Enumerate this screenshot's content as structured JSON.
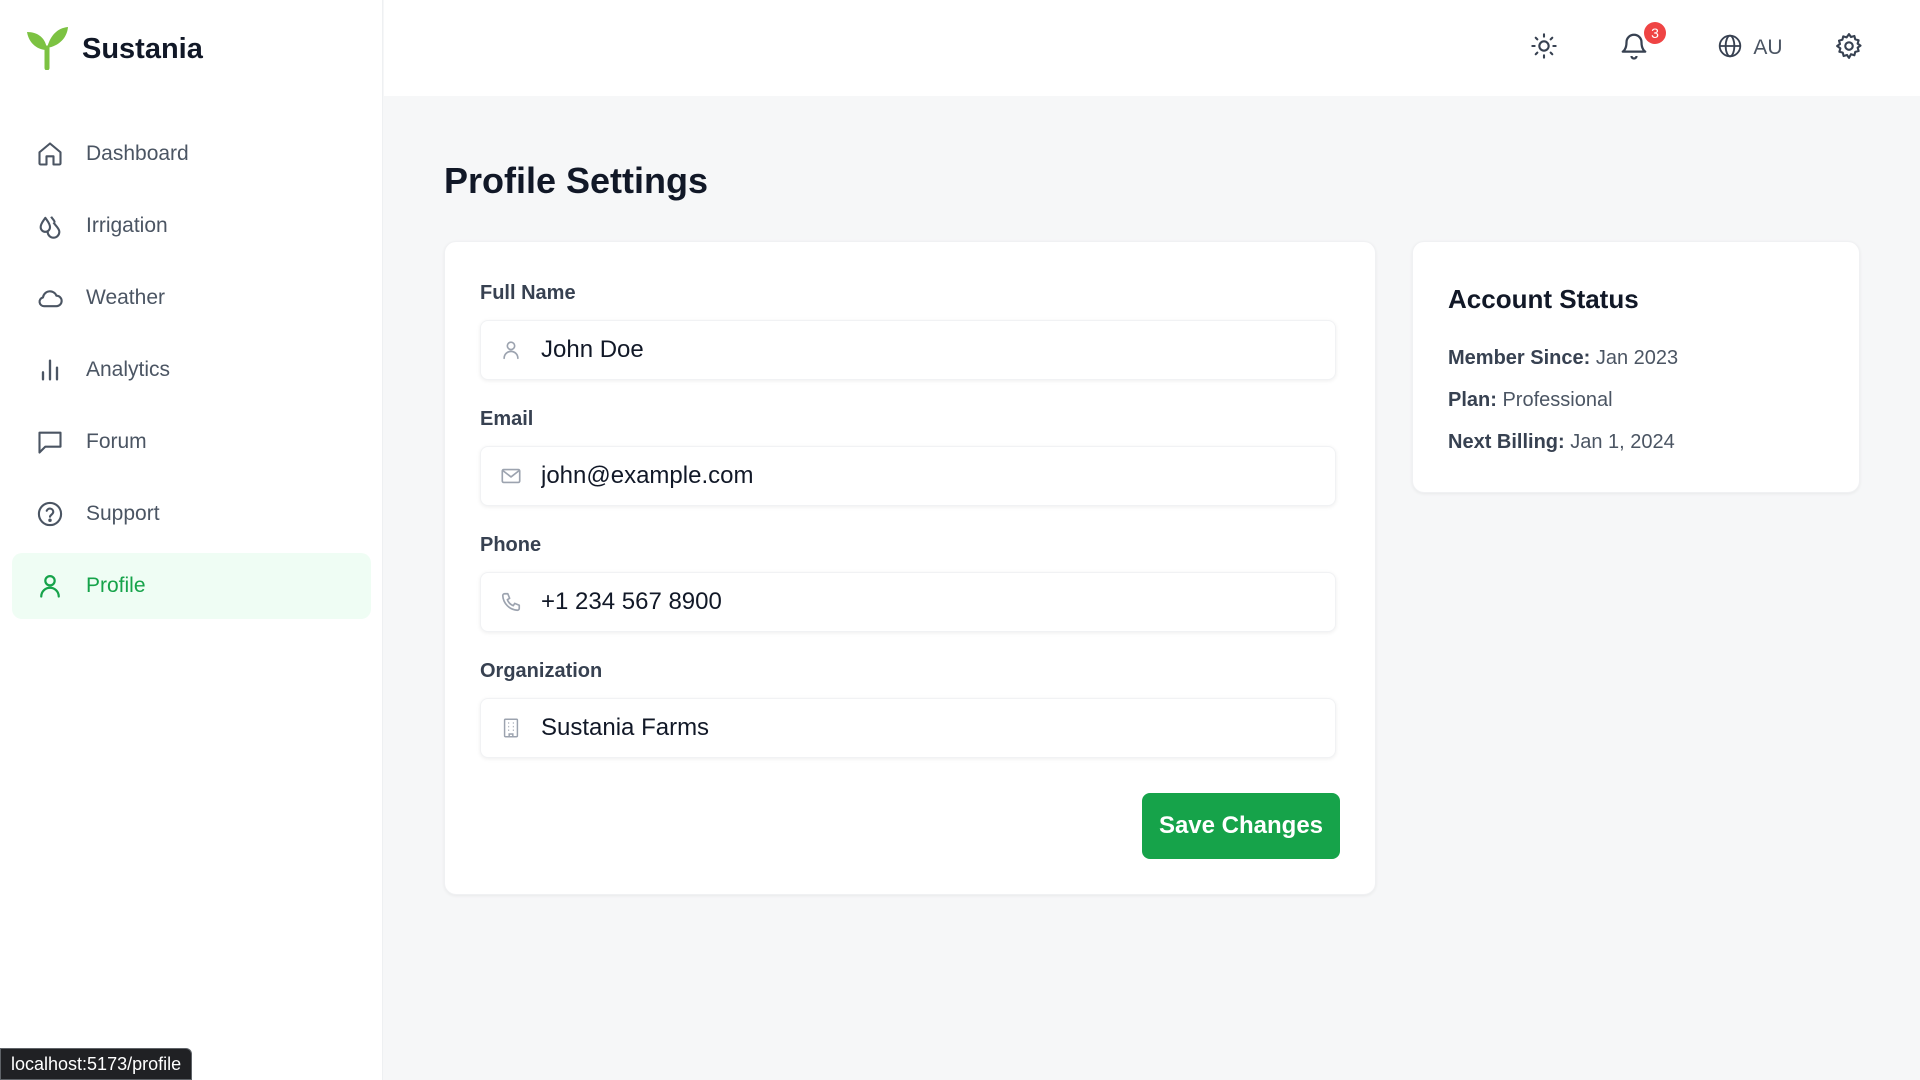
{
  "brand": {
    "name": "Sustania",
    "logo_icon": "seedling-icon",
    "logo_color": "#7cc242"
  },
  "sidebar": {
    "items": [
      {
        "label": "Dashboard",
        "icon": "home-icon"
      },
      {
        "label": "Irrigation",
        "icon": "droplets-icon"
      },
      {
        "label": "Weather",
        "icon": "cloud-icon"
      },
      {
        "label": "Analytics",
        "icon": "bar-chart-icon"
      },
      {
        "label": "Forum",
        "icon": "message-square-icon"
      },
      {
        "label": "Support",
        "icon": "help-circle-icon"
      },
      {
        "label": "Profile",
        "icon": "user-icon",
        "active": true
      }
    ],
    "active_color": "#16a34a"
  },
  "topbar": {
    "theme_icon": "sun-icon",
    "notifications_icon": "bell-icon",
    "notifications_count": "3",
    "language_icon": "globe-icon",
    "language_label": "AU",
    "settings_icon": "gear-icon"
  },
  "page": {
    "title": "Profile Settings"
  },
  "form": {
    "fields": [
      {
        "label": "Full Name",
        "value": "John Doe",
        "icon": "user-icon"
      },
      {
        "label": "Email",
        "value": "john@example.com",
        "icon": "mail-icon"
      },
      {
        "label": "Phone",
        "value": "+1 234 567 8900",
        "icon": "phone-icon"
      },
      {
        "label": "Organization",
        "value": "Sustania Farms",
        "icon": "building-icon"
      }
    ],
    "save_label": "Save Changes",
    "save_color": "#16a34a"
  },
  "account_status": {
    "title": "Account Status",
    "member_since_label": "Member Since:",
    "member_since_value": "Jan 2023",
    "plan_label": "Plan:",
    "plan_value": "Professional",
    "next_billing_label": "Next Billing:",
    "next_billing_value": "Jan 1, 2024"
  },
  "status_bar": {
    "url": "localhost:5173/profile"
  }
}
